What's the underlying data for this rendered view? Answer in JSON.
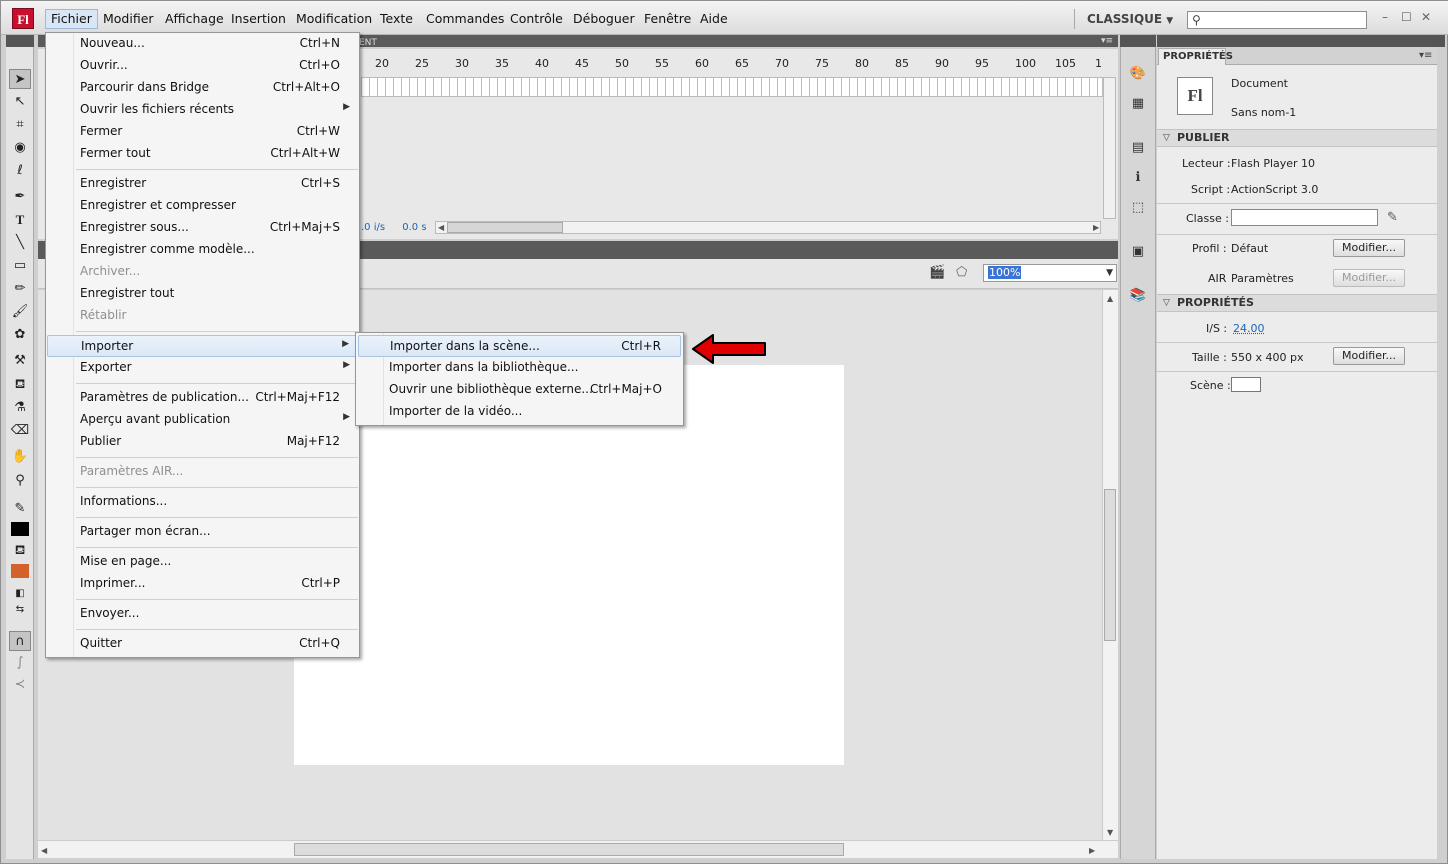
{
  "app": {
    "logo": "Fl"
  },
  "menubar": {
    "items": [
      "Fichier",
      "Modifier",
      "Affichage",
      "Insertion",
      "Modification",
      "Texte",
      "Commandes",
      "Contrôle",
      "Déboguer",
      "Fenêtre",
      "Aide"
    ],
    "workspace": "CLASSIQUE",
    "workspace_icon": "chevron-down-icon",
    "search_placeholder": "",
    "search_icon": "search-icon"
  },
  "timeline": {
    "tab_partial": "ENT",
    "ruler": [
      "20",
      "25",
      "30",
      "35",
      "40",
      "45",
      "50",
      "55",
      "60",
      "65",
      "70",
      "75",
      "80",
      "85",
      "90",
      "95",
      "100",
      "105",
      "1"
    ],
    "fps_partial": ".0 i/s",
    "time": "0.0 s"
  },
  "stage": {
    "zoom": "100%"
  },
  "file_menu": {
    "items": [
      {
        "label": "Nouveau...",
        "shortcut": "Ctrl+N"
      },
      {
        "label": "Ouvrir...",
        "shortcut": "Ctrl+O"
      },
      {
        "label": "Parcourir dans Bridge",
        "shortcut": "Ctrl+Alt+O"
      },
      {
        "label": "Ouvrir les fichiers récents",
        "shortcut": ""
      },
      {
        "label": "Fermer",
        "shortcut": "Ctrl+W"
      },
      {
        "label": "Fermer tout",
        "shortcut": "Ctrl+Alt+W"
      },
      {
        "label": "Enregistrer",
        "shortcut": "Ctrl+S"
      },
      {
        "label": "Enregistrer et compresser",
        "shortcut": ""
      },
      {
        "label": "Enregistrer sous...",
        "shortcut": "Ctrl+Maj+S"
      },
      {
        "label": "Enregistrer comme modèle...",
        "shortcut": ""
      },
      {
        "label": "Archiver...",
        "shortcut": ""
      },
      {
        "label": "Enregistrer tout",
        "shortcut": ""
      },
      {
        "label": "Rétablir",
        "shortcut": ""
      },
      {
        "label": "Importer",
        "shortcut": ""
      },
      {
        "label": "Exporter",
        "shortcut": ""
      },
      {
        "label": "Paramètres de publication...",
        "shortcut": "Ctrl+Maj+F12"
      },
      {
        "label": "Aperçu avant publication",
        "shortcut": ""
      },
      {
        "label": "Publier",
        "shortcut": "Maj+F12"
      },
      {
        "label": "Paramètres AIR...",
        "shortcut": ""
      },
      {
        "label": "Informations...",
        "shortcut": ""
      },
      {
        "label": "Partager mon écran...",
        "shortcut": ""
      },
      {
        "label": "Mise en page...",
        "shortcut": ""
      },
      {
        "label": "Imprimer...",
        "shortcut": "Ctrl+P"
      },
      {
        "label": "Envoyer...",
        "shortcut": ""
      },
      {
        "label": "Quitter",
        "shortcut": "Ctrl+Q"
      }
    ]
  },
  "import_submenu": {
    "items": [
      {
        "label": "Importer dans la scène...",
        "shortcut": "Ctrl+R"
      },
      {
        "label": "Importer dans la bibliothèque...",
        "shortcut": ""
      },
      {
        "label": "Ouvrir une bibliothèque externe...",
        "shortcut": "Ctrl+Maj+O"
      },
      {
        "label": "Importer de la vidéo...",
        "shortcut": ""
      }
    ]
  },
  "properties": {
    "tab": "PROPRIÉTÉS",
    "doc_icon": "Fl",
    "doc_type": "Document",
    "doc_name": "Sans nom-1",
    "publish_header": "PUBLIER",
    "player_label": "Lecteur :",
    "player_value": "Flash Player 10",
    "script_label": "Script :",
    "script_value": "ActionScript 3.0",
    "class_label": "Classe :",
    "class_value": "",
    "profile_label": "Profil :",
    "profile_value": "Défaut",
    "modify_label": "Modifier...",
    "air_label": "AIR",
    "air_value": "Paramètres",
    "props_header": "PROPRIÉTÉS",
    "fps_label": "I/S :",
    "fps_value": "24.00",
    "size_label": "Taille :",
    "size_value": "550 x 400 px",
    "stage_label": "Scène :",
    "stage_color": "#ffffff"
  },
  "colors": {
    "accent": "#3875d7",
    "logo_red": "#c8102e",
    "arrow_red": "#e00000",
    "fill_orange": "#d2622a"
  }
}
